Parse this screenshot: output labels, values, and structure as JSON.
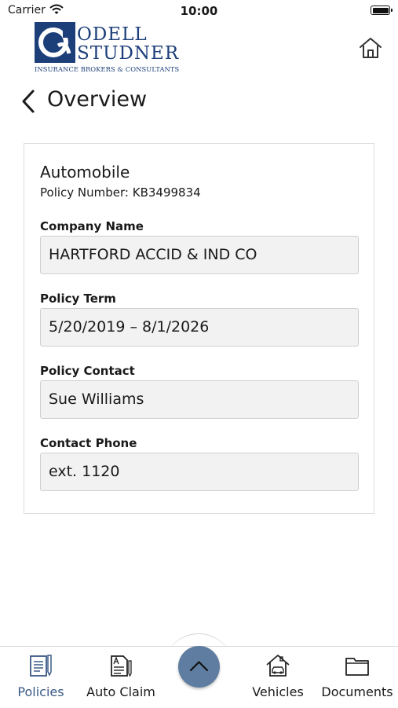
{
  "status_bar": {
    "carrier": "Carrier",
    "time": "10:00"
  },
  "logo": {
    "line1": "ODELL",
    "line2": "STUDNER",
    "tagline": "INSURANCE BROKERS & CONSULTANTS"
  },
  "header": {
    "title": "Overview"
  },
  "policy": {
    "type": "Automobile",
    "number_label": "Policy Number:",
    "number": "KB3499834",
    "fields": [
      {
        "label": "Company Name",
        "value": "HARTFORD ACCID & IND CO"
      },
      {
        "label": "Policy Term",
        "value": "5/20/2019 – 8/1/2026"
      },
      {
        "label": "Policy Contact",
        "value": "Sue Williams"
      },
      {
        "label": "Contact Phone",
        "value": "ext. 1120"
      }
    ]
  },
  "tab_bar": {
    "tabs": [
      {
        "label": "Policies",
        "icon": "policies-icon",
        "active": true
      },
      {
        "label": "Auto Claim",
        "icon": "auto-claim-icon",
        "active": false
      },
      {
        "label": "Vehicles",
        "icon": "vehicles-icon",
        "active": false
      },
      {
        "label": "Documents",
        "icon": "documents-icon",
        "active": false
      }
    ],
    "center_icon": "chevron-up-icon"
  },
  "colors": {
    "brand": "#1c3f7a",
    "active_tab": "#3a5a86",
    "center_button": "#5f7da0",
    "field_background": "#f2f2f2"
  }
}
